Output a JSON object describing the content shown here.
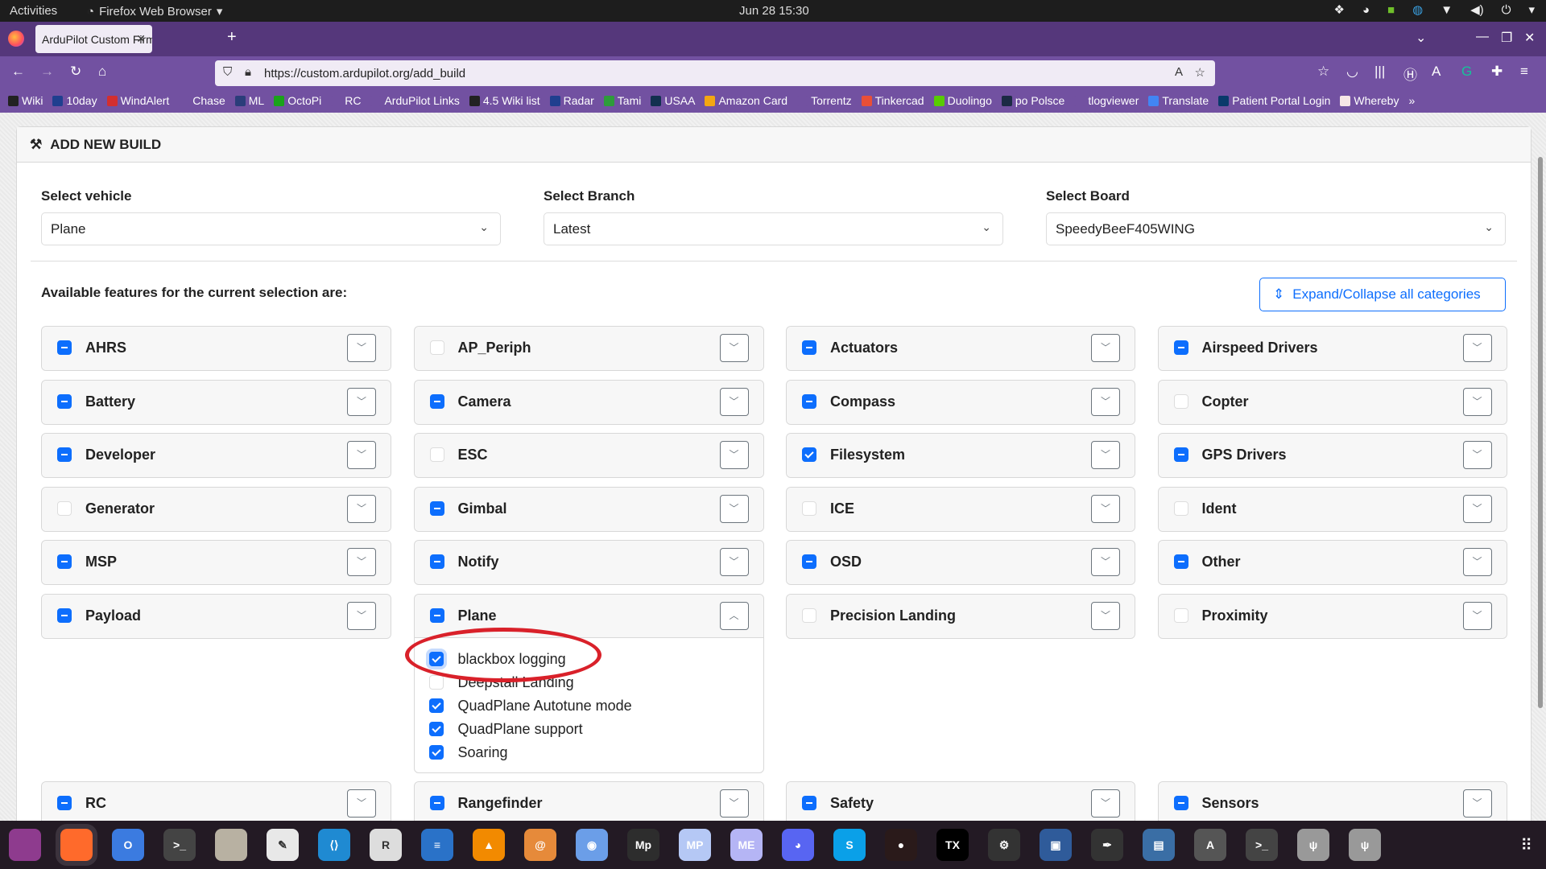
{
  "system": {
    "activities": "Activities",
    "app_menu": "Firefox Web Browser",
    "clock": "Jun 28  15:30",
    "tray_icons": [
      "dropbox-icon",
      "discord-icon",
      "shield-check-icon",
      "sync-icon",
      "wifi-icon",
      "volume-icon",
      "power-icon",
      "menu-down-icon"
    ]
  },
  "browser": {
    "tab_title": "ArduPilot Custom Firmware",
    "url": "https://custom.ardupilot.org/add_build",
    "bookmarks": [
      {
        "label": "Wiki",
        "color": "#222"
      },
      {
        "label": "10day",
        "color": "#1f3f8f"
      },
      {
        "label": "WindAlert",
        "color": "#d32f2f"
      },
      {
        "label": "Chase",
        "color": "#7251a1"
      },
      {
        "label": "ML",
        "color": "#2b3d7a"
      },
      {
        "label": "OctoPi",
        "color": "#1aa31a"
      },
      {
        "label": "RC",
        "color": "#7251a1"
      },
      {
        "label": "ArduPilot Links",
        "color": "#7251a1"
      },
      {
        "label": "4.5 Wiki list",
        "color": "#222"
      },
      {
        "label": "Radar",
        "color": "#1f3f8f"
      },
      {
        "label": "Tami",
        "color": "#2e9c3a"
      },
      {
        "label": "USAA",
        "color": "#12304f"
      },
      {
        "label": "Amazon  Card",
        "color": "#f3a712"
      },
      {
        "label": "Torrentz",
        "color": "#7251a1"
      },
      {
        "label": "Tinkercad",
        "color": "#e94f37"
      },
      {
        "label": "Duolingo",
        "color": "#58cc02"
      },
      {
        "label": "po Polsce",
        "color": "#1b2a44"
      },
      {
        "label": "tlogviewer",
        "color": "#7251a1"
      },
      {
        "label": "Translate",
        "color": "#4285f4"
      },
      {
        "label": "Patient Portal Login",
        "color": "#0a3a6b"
      },
      {
        "label": "Whereby",
        "color": "#f6e6e6"
      }
    ]
  },
  "page": {
    "header": "ADD NEW BUILD",
    "vehicle": {
      "label": "Select vehicle",
      "value": "Plane"
    },
    "branch": {
      "label": "Select Branch",
      "value": "Latest"
    },
    "board": {
      "label": "Select Board",
      "value": "SpeedyBeeF405WING"
    },
    "available": "Available features for the current selection are:",
    "expand_button": "Expand/Collapse all categories",
    "categories": [
      {
        "name": "AHRS",
        "state": "indeterminate"
      },
      {
        "name": "AP_Periph",
        "state": "unchecked"
      },
      {
        "name": "Actuators",
        "state": "indeterminate"
      },
      {
        "name": "Airspeed Drivers",
        "state": "indeterminate"
      },
      {
        "name": "Battery",
        "state": "indeterminate"
      },
      {
        "name": "Camera",
        "state": "indeterminate"
      },
      {
        "name": "Compass",
        "state": "indeterminate"
      },
      {
        "name": "Copter",
        "state": "unchecked"
      },
      {
        "name": "Developer",
        "state": "indeterminate"
      },
      {
        "name": "ESC",
        "state": "unchecked"
      },
      {
        "name": "Filesystem",
        "state": "checked"
      },
      {
        "name": "GPS Drivers",
        "state": "indeterminate"
      },
      {
        "name": "Generator",
        "state": "unchecked"
      },
      {
        "name": "Gimbal",
        "state": "indeterminate"
      },
      {
        "name": "ICE",
        "state": "unchecked"
      },
      {
        "name": "Ident",
        "state": "unchecked"
      },
      {
        "name": "MSP",
        "state": "indeterminate"
      },
      {
        "name": "Notify",
        "state": "indeterminate"
      },
      {
        "name": "OSD",
        "state": "indeterminate"
      },
      {
        "name": "Other",
        "state": "indeterminate"
      },
      {
        "name": "Payload",
        "state": "indeterminate"
      },
      {
        "name": "Plane",
        "state": "indeterminate",
        "expanded": true,
        "options": [
          {
            "label": "blackbox logging",
            "checked": true,
            "highlighted": true
          },
          {
            "label": "Deepstall Landing",
            "checked": false
          },
          {
            "label": "QuadPlane Autotune mode",
            "checked": true
          },
          {
            "label": "QuadPlane support",
            "checked": true
          },
          {
            "label": "Soaring",
            "checked": true
          }
        ]
      },
      {
        "name": "Precision Landing",
        "state": "unchecked"
      },
      {
        "name": "Proximity",
        "state": "unchecked"
      },
      {
        "name": "RC",
        "state": "indeterminate"
      },
      {
        "name": "Rangefinder",
        "state": "indeterminate"
      },
      {
        "name": "Safety",
        "state": "indeterminate"
      },
      {
        "name": "Sensors",
        "state": "indeterminate"
      }
    ]
  },
  "taskbar": [
    {
      "icon": "workspaces-icon",
      "color": "#8e3b8e",
      "glyph": ""
    },
    {
      "icon": "firefox-icon",
      "color": "#ff6a2b",
      "glyph": "",
      "active": true
    },
    {
      "icon": "chromium-icon",
      "color": "#3b7be0",
      "glyph": "O"
    },
    {
      "icon": "terminal-icon",
      "color": "#444",
      "glyph": ">_"
    },
    {
      "icon": "files-icon",
      "color": "#b8b1a2",
      "glyph": ""
    },
    {
      "icon": "text-editor-icon",
      "color": "#e8e8e8",
      "glyph": "✎"
    },
    {
      "icon": "vscode-icon",
      "color": "#1f8ad2",
      "glyph": "⟨⟩"
    },
    {
      "icon": "r-icon",
      "color": "#ddd",
      "glyph": "R"
    },
    {
      "icon": "writer-icon",
      "color": "#2a72c8",
      "glyph": "≡"
    },
    {
      "icon": "vlc-icon",
      "color": "#f28a00",
      "glyph": "▲"
    },
    {
      "icon": "blender-icon",
      "color": "#e68a3a",
      "glyph": "@"
    },
    {
      "icon": "store-icon",
      "color": "#6b9ee8",
      "glyph": "◉"
    },
    {
      "icon": "mission-planner-icon",
      "color": "#2d2d2d",
      "glyph": "Mp"
    },
    {
      "icon": "mavproxy-icon",
      "color": "#b5c8f5",
      "glyph": "MP"
    },
    {
      "icon": "mavexplorer-icon",
      "color": "#b5b5f5",
      "glyph": "ME"
    },
    {
      "icon": "discord-icon",
      "color": "#5865f2",
      "glyph": "◕"
    },
    {
      "icon": "skype-icon",
      "color": "#0aa0e8",
      "glyph": "S"
    },
    {
      "icon": "screen-recorder-icon",
      "color": "#2a1a1a",
      "glyph": "●"
    },
    {
      "icon": "opentx-icon",
      "color": "#000",
      "glyph": "TX"
    },
    {
      "icon": "usb-tool-icon",
      "color": "#333",
      "glyph": "⚙"
    },
    {
      "icon": "virtualbox-icon",
      "color": "#2f5b9a",
      "glyph": "▣"
    },
    {
      "icon": "inkscape-icon",
      "color": "#333",
      "glyph": "✒"
    },
    {
      "icon": "remote-desktop-icon",
      "color": "#3a6ea5",
      "glyph": "▤"
    },
    {
      "icon": "software-updater-icon",
      "color": "#555",
      "glyph": "A"
    },
    {
      "icon": "terminal-2-icon",
      "color": "#444",
      "glyph": ">_"
    },
    {
      "icon": "usb-drive-icon",
      "color": "#999",
      "glyph": "ψ"
    },
    {
      "icon": "usb-drive-2-icon",
      "color": "#999",
      "glyph": "ψ"
    }
  ]
}
